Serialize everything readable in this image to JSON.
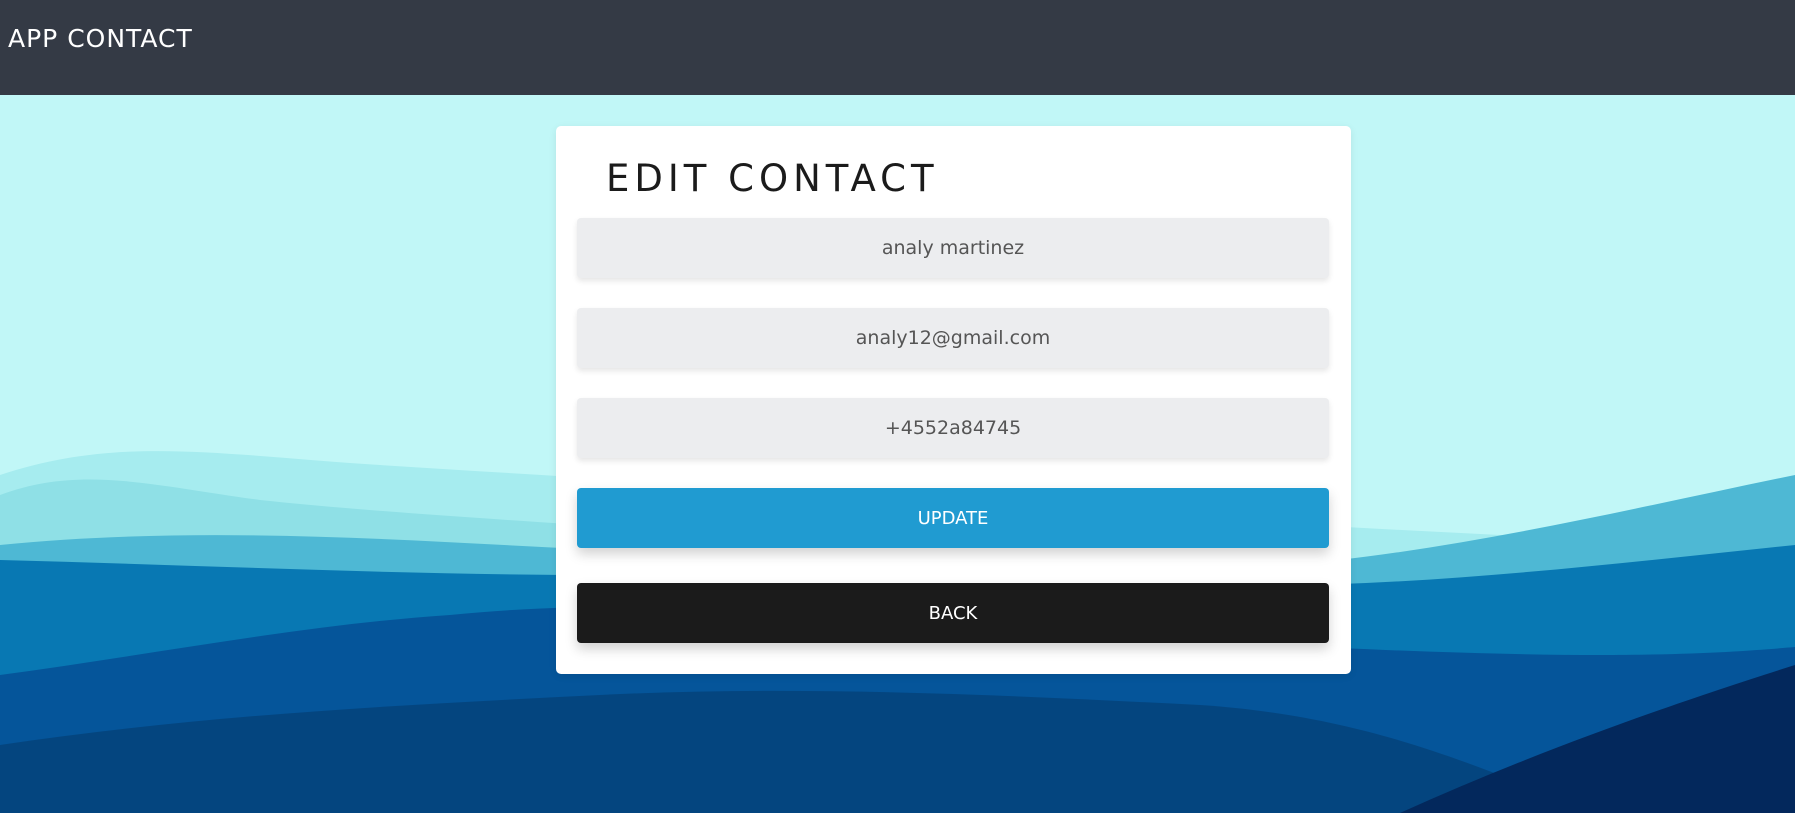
{
  "navbar": {
    "brand": "APP CONTACT",
    "background_color": "#343a45"
  },
  "background": {
    "sky_color": "#c1f7f7",
    "wave_colors": [
      "#a6ecef",
      "#4eb8d4",
      "#0878b3",
      "#05559a",
      "#04386d"
    ]
  },
  "form": {
    "title": "EDIT CONTACT",
    "fields": {
      "name": {
        "value": "analy martinez"
      },
      "email": {
        "value": "analy12@gmail.com"
      },
      "phone": {
        "value": "+4552a84745"
      }
    },
    "update_label": "UPDATE",
    "back_label": "BACK",
    "update_color": "#209bd1",
    "back_color": "#1b1b1b"
  }
}
